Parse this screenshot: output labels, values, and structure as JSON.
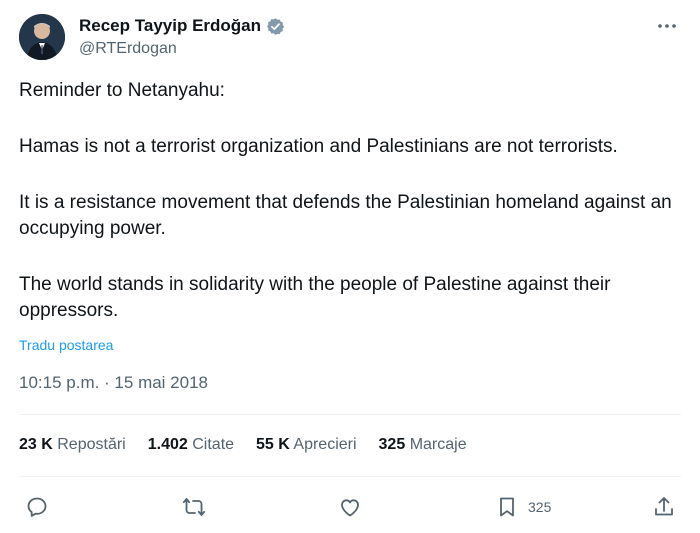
{
  "author": {
    "display_name": "Recep Tayyip Erdoğan",
    "handle": "@RTErdogan"
  },
  "tweet": {
    "paragraphs": [
      "Reminder to Netanyahu:",
      "Hamas is not a terrorist organization and Palestinians are not terrorists.",
      "It is a resistance movement that defends the Palestinian homeland against an occupying power.",
      "The world stands in solidarity with the people of Palestine against their oppressors."
    ],
    "translate_label": "Tradu postarea",
    "timestamp": "10:15 p.m. · 15 mai 2018"
  },
  "stats": {
    "reposts": {
      "count": "23 K",
      "label": "Repostări"
    },
    "quotes": {
      "count": "1.402",
      "label": "Citate"
    },
    "likes": {
      "count": "55 K",
      "label": "Aprecieri"
    },
    "bookmarks": {
      "count": "325",
      "label": "Marcaje"
    }
  },
  "actions": {
    "bookmark_count": "325"
  },
  "colors": {
    "link": "#1d9bf0",
    "secondary_text": "#536471",
    "primary_text": "#0f1419",
    "divider": "#eff3f4"
  },
  "icons": [
    "verified-badge-icon",
    "more-icon",
    "reply-icon",
    "repost-icon",
    "like-icon",
    "bookmark-icon",
    "share-icon"
  ]
}
